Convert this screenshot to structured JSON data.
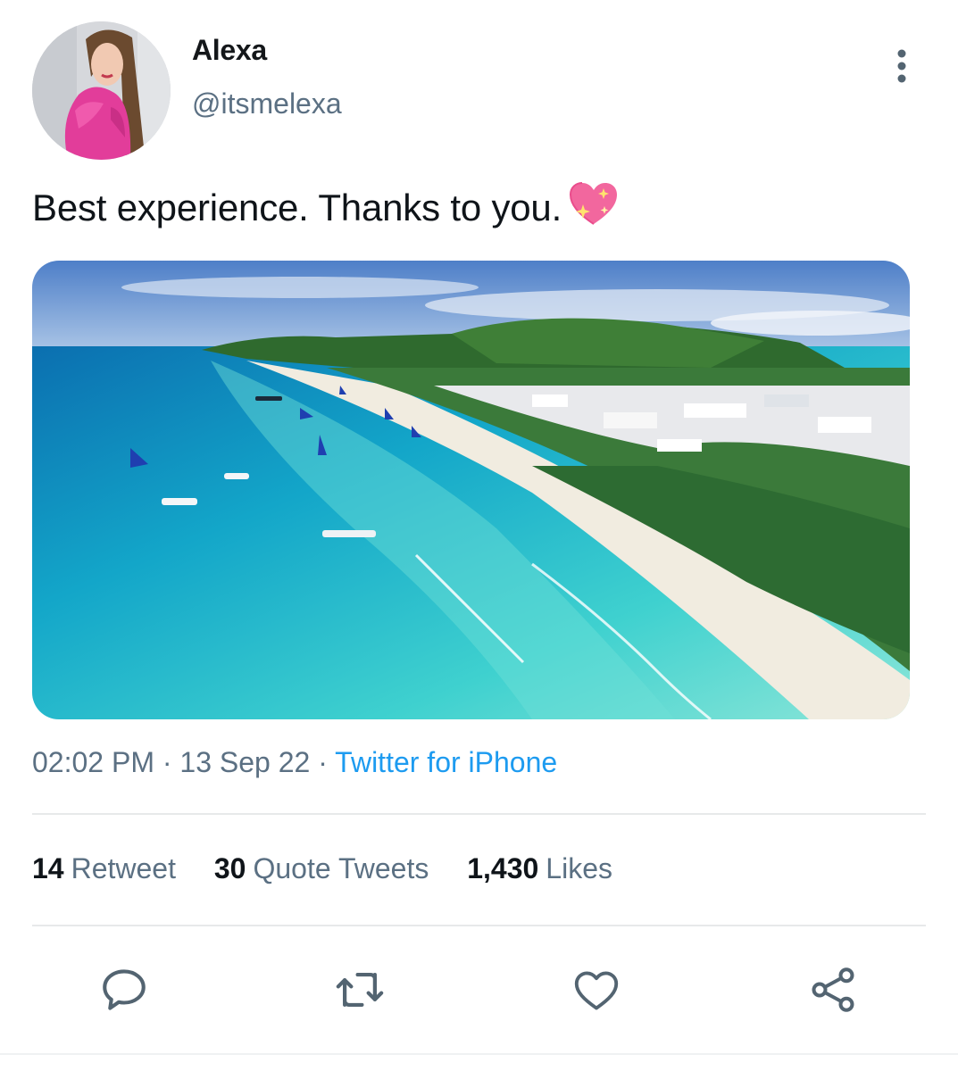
{
  "user": {
    "display_name": "Alexa",
    "handle": "@itsmelexa"
  },
  "tweet": {
    "text": "Best experience. Thanks to you.",
    "emoji": "sparkling-heart"
  },
  "meta": {
    "time": "02:02 PM",
    "separator": " · ",
    "date": "13 Sep 22",
    "source": "Twitter for iPhone"
  },
  "stats": {
    "retweets": {
      "count": "14",
      "label": "Retweet"
    },
    "quotes": {
      "count": "30",
      "label": "Quote Tweets"
    },
    "likes": {
      "count": "1,430",
      "label": "Likes"
    }
  },
  "actions": [
    "reply-icon",
    "retweet-icon",
    "like-icon",
    "share-icon"
  ],
  "colors": {
    "link": "#1d9bf0",
    "secondary_text": "#5b7083",
    "icon": "#536471"
  }
}
